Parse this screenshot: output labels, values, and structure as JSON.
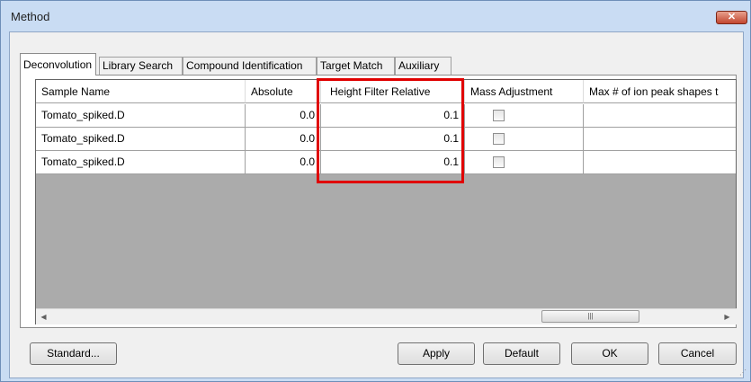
{
  "window": {
    "title": "Method",
    "close_label": "✕"
  },
  "tabs": [
    {
      "label": "Deconvolution",
      "active": true
    },
    {
      "label": "Library Search",
      "active": false
    },
    {
      "label": "Compound Identification",
      "active": false
    },
    {
      "label": "Target Match",
      "active": false
    },
    {
      "label": "Auxiliary",
      "active": false
    }
  ],
  "grid": {
    "columns": [
      "Sample Name",
      "Absolute",
      "Height Filter Relative",
      "Mass Adjustment",
      "Max # of ion peak shapes t"
    ],
    "rows": [
      {
        "sample_name": "Tomato_spiked.D",
        "absolute": "0.0",
        "relative": "0.1",
        "mass_adjustment": false
      },
      {
        "sample_name": "Tomato_spiked.D",
        "absolute": "0.0",
        "relative": "0.1",
        "mass_adjustment": false
      },
      {
        "sample_name": "Tomato_spiked.D",
        "absolute": "0.0",
        "relative": "0.1",
        "mass_adjustment": false
      }
    ],
    "highlight_column": "Height Filter Relative",
    "highlight_color": "#e00000"
  },
  "scrollbar": {
    "left_arrow": "◀",
    "right_arrow": "▶",
    "thumb_grip": "|||"
  },
  "buttons": {
    "standard": "Standard...",
    "apply": "Apply",
    "default": "Default",
    "ok": "OK",
    "cancel": "Cancel"
  }
}
